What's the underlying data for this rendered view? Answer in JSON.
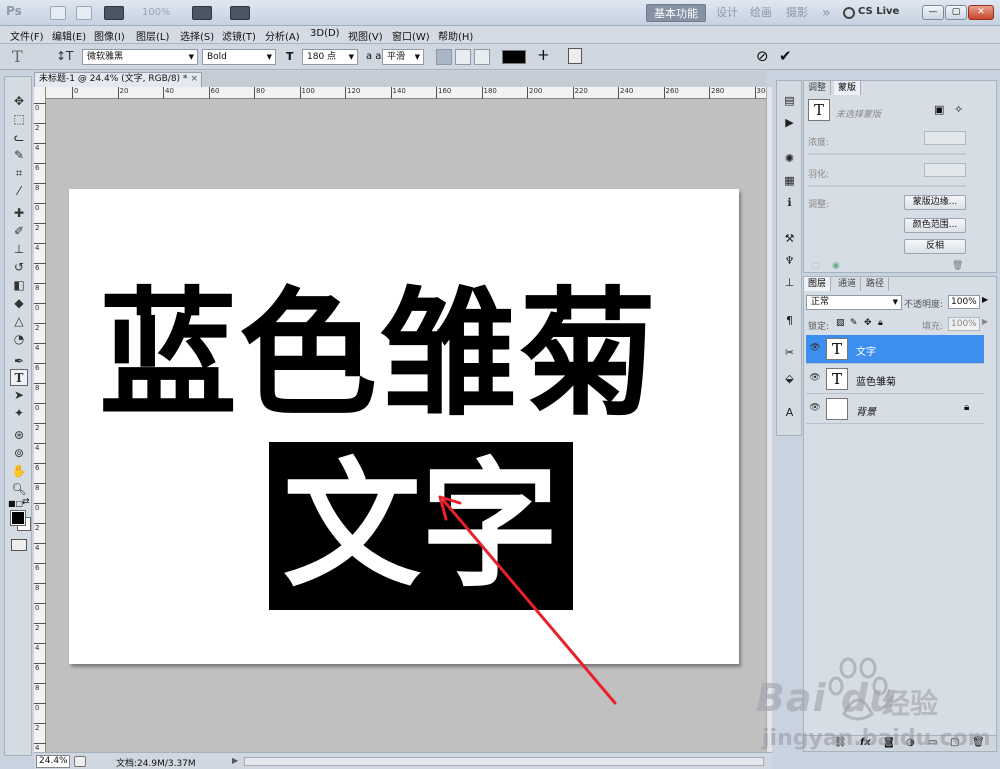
{
  "titlebar": {
    "logo": "Ps",
    "zoom": "100%",
    "workspaces": [
      "基本功能",
      "设计",
      "绘画",
      "摄影"
    ],
    "more": "»",
    "cslive": "CS Live"
  },
  "menu": [
    "文件(F)",
    "编辑(E)",
    "图像(I)",
    "图层(L)",
    "选择(S)",
    "滤镜(T)",
    "分析(A)",
    "3D(D)",
    "视图(V)",
    "窗口(W)",
    "帮助(H)"
  ],
  "options": {
    "font_family": "微软雅黑",
    "font_style": "Bold",
    "font_size": "180 点",
    "antialias_label": "a a",
    "antialias": "平滑",
    "text_color": "#000000"
  },
  "document": {
    "tab_title": "未标题-1 @ 24.4% (文字, RGB/8) *",
    "close": "×",
    "ruler_h": [
      "4",
      "0",
      "20",
      "40",
      "60",
      "80",
      "100",
      "120",
      "140",
      "160",
      "180",
      "200",
      "220",
      "240",
      "260",
      "280",
      "300"
    ],
    "ruler_v": [
      "0",
      "2",
      "4",
      "6",
      "8",
      "0",
      "2",
      "4",
      "6",
      "8",
      "0",
      "2",
      "4",
      "6",
      "8",
      "0",
      "2",
      "4",
      "6",
      "8",
      "0",
      "2",
      "4",
      "6",
      "8",
      "0",
      "2",
      "4",
      "6",
      "8",
      "0",
      "2",
      "4"
    ],
    "line1": "蓝色雏菊",
    "line2": "文字"
  },
  "status": {
    "zoom": "24.4%",
    "doc": "文档:24.9M/3.37M"
  },
  "masks_panel": {
    "tabs": [
      "调整",
      "蒙版"
    ],
    "no_selection": "未选择蒙版",
    "density": "浓度:",
    "feather": "羽化:",
    "refine": "调整:",
    "btn_edge": "蒙版边缘...",
    "btn_color_range": "颜色范围...",
    "btn_invert": "反相"
  },
  "layers_panel": {
    "tabs": [
      "图层",
      "通道",
      "路径"
    ],
    "blend_mode": "正常",
    "opacity_label": "不透明度:",
    "opacity": "100%",
    "lock_label": "锁定:",
    "fill_label": "填充:",
    "fill": "100%",
    "layers": [
      {
        "name": "文字",
        "thumb": "T",
        "selected": true
      },
      {
        "name": "蓝色雏菊",
        "thumb": "T",
        "selected": false
      },
      {
        "name": "背景",
        "thumb": "",
        "selected": false
      }
    ],
    "footer_icons": [
      "link-icon",
      "fx-icon",
      "mask-icon",
      "adjustment-icon",
      "group-icon",
      "new-layer-icon",
      "trash-icon"
    ]
  },
  "watermark": {
    "brand": "Bai du",
    "cn": "经验",
    "url": "jingyan.baidu.com"
  },
  "colors": {
    "selection_blue": "#3d8fef",
    "arrow_red": "#e8202a"
  }
}
